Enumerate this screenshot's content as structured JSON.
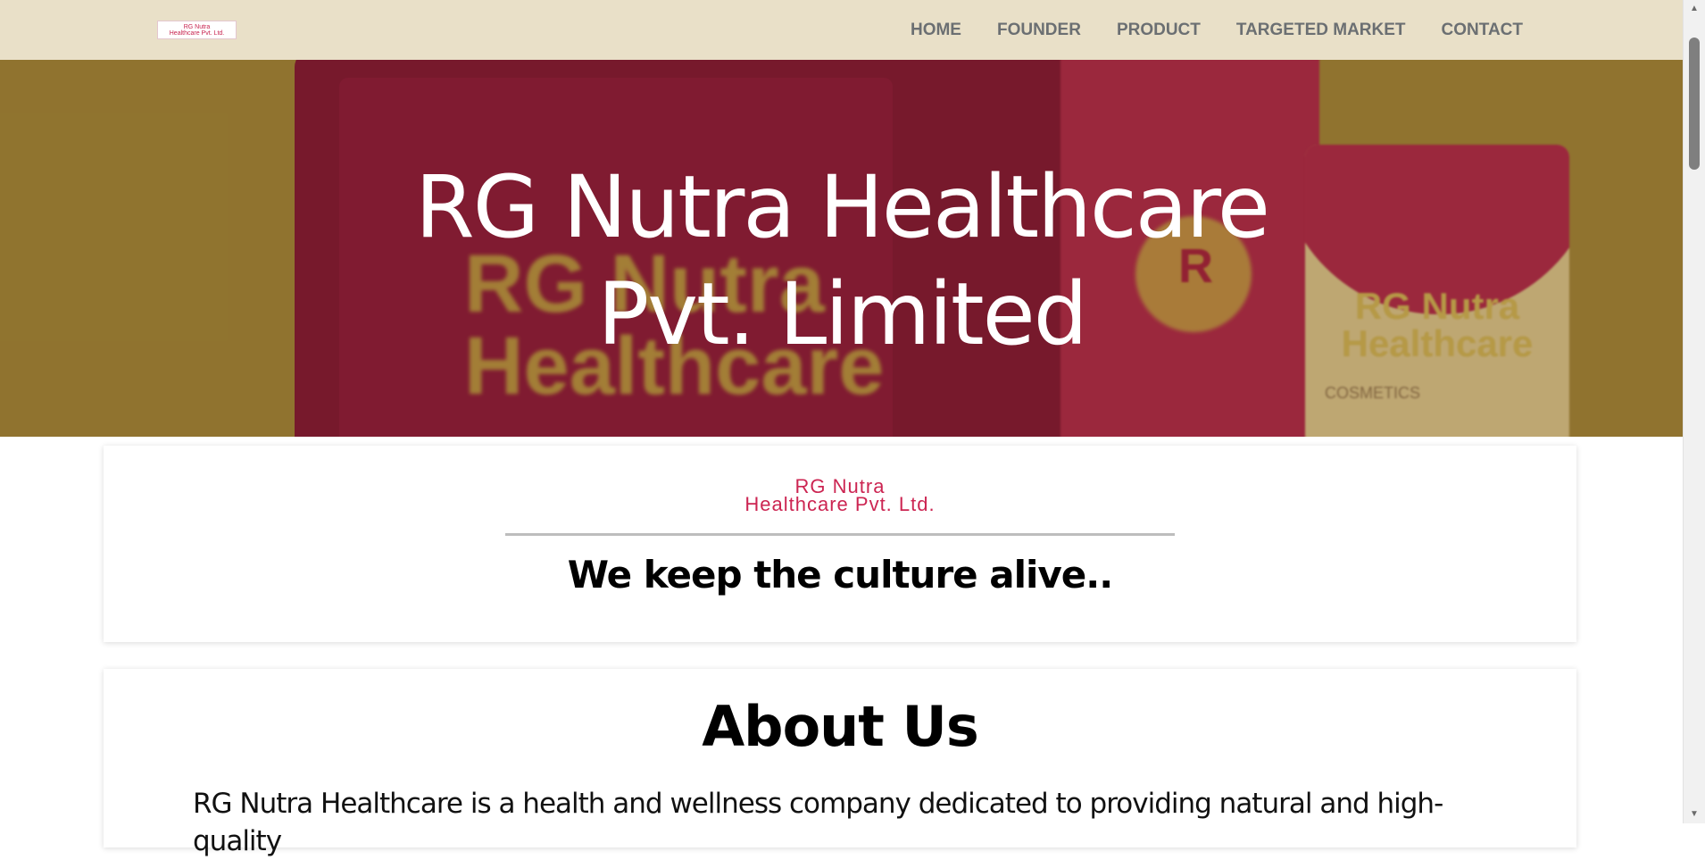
{
  "navbar": {
    "logo_line1": "RG Nutra",
    "logo_line2": "Healthcare Pvt. Ltd.",
    "links": [
      "HOME",
      "FOUNDER",
      "PRODUCT",
      "TARGETED MARKET",
      "CONTACT"
    ]
  },
  "hero": {
    "title_line1": "RG Nutra Healthcare",
    "title_line2": "Pvt. Limited",
    "bag_text_line1": "RG Nutra",
    "bag_text_line2": "Healthcare",
    "tube_letter": "R",
    "pouch_text_line1": "RG Nutra",
    "pouch_text_line2": "Healthcare",
    "pouch_label": "COSMETICS"
  },
  "brand_card": {
    "logo_line1": "RG Nutra",
    "logo_line2": "Healthcare Pvt. Ltd.",
    "tagline": "We keep the culture alive.."
  },
  "about": {
    "heading": "About Us",
    "text": "RG Nutra Healthcare is a health and wellness company dedicated to providing natural and high-quality"
  },
  "colors": {
    "nav_bg": "#e9e0c8",
    "hero_bg": "#977b31",
    "brand_pink": "#cc2552"
  }
}
